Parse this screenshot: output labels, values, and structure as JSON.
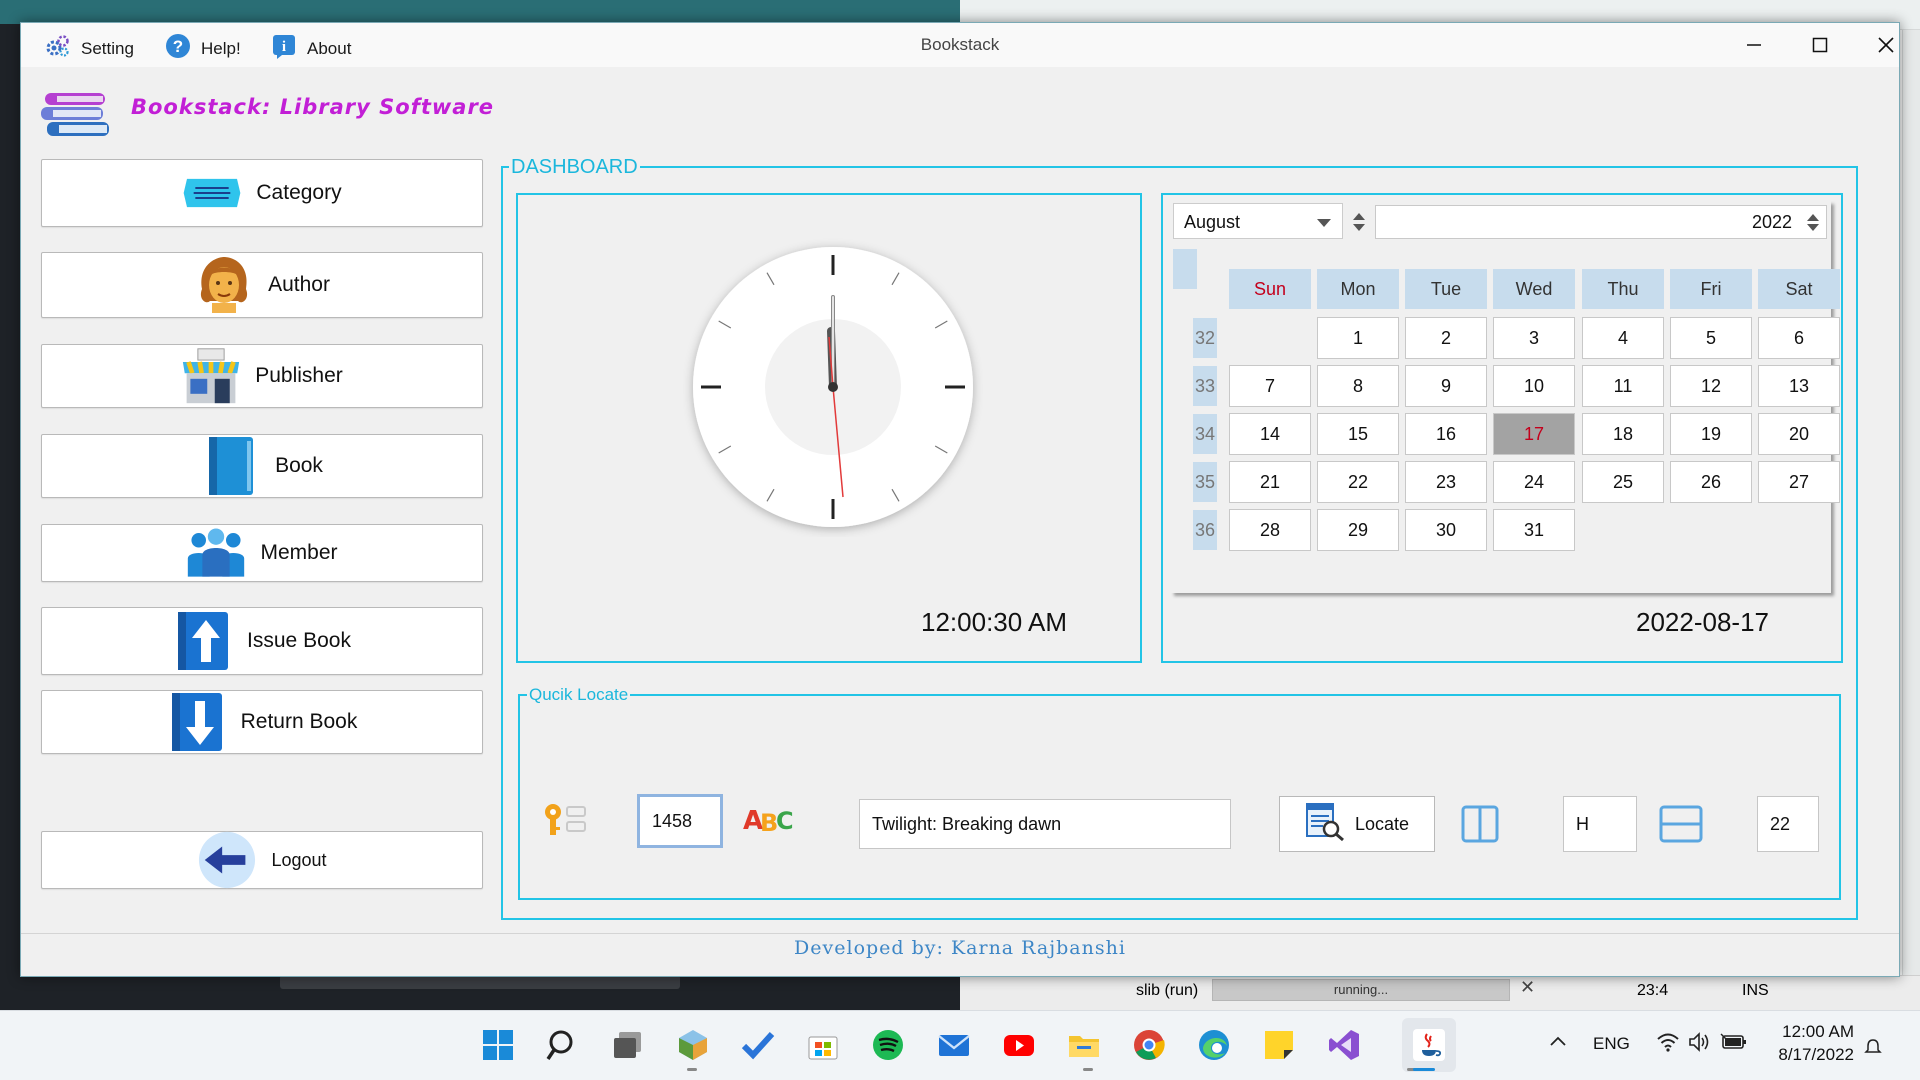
{
  "window": {
    "title": "Bookstack",
    "menu": [
      {
        "label": "Setting",
        "icon": "gears-icon"
      },
      {
        "label": "Help!",
        "icon": "help-icon"
      },
      {
        "label": "About",
        "icon": "info-icon"
      }
    ]
  },
  "app": {
    "title": "Bookstack: Library Software",
    "title_color": "#c21fd6",
    "logo_icon": "books-stack-icon"
  },
  "sidebar": {
    "items": [
      {
        "label": "Category",
        "icon": "category-icon"
      },
      {
        "label": "Author",
        "icon": "author-icon"
      },
      {
        "label": "Publisher",
        "icon": "publisher-icon"
      },
      {
        "label": "Book",
        "icon": "book-icon"
      },
      {
        "label": "Member",
        "icon": "member-icon"
      },
      {
        "label": "Issue Book",
        "icon": "issue-book-icon"
      },
      {
        "label": "Return Book",
        "icon": "return-book-icon"
      }
    ],
    "logout": {
      "label": "Logout",
      "icon": "back-arrow-icon"
    }
  },
  "dashboard": {
    "legend": "DASHBOARD",
    "accent_color": "#22c4e6",
    "time": "12:00:30 AM",
    "date": "2022-08-17",
    "calendar": {
      "month": "August",
      "year": "2022",
      "weekdays": [
        "Sun",
        "Mon",
        "Tue",
        "Wed",
        "Thu",
        "Fri",
        "Sat"
      ],
      "weeks": [
        {
          "num": "32",
          "days": [
            "",
            "1",
            "2",
            "3",
            "4",
            "5",
            "6"
          ]
        },
        {
          "num": "33",
          "days": [
            "7",
            "8",
            "9",
            "10",
            "11",
            "12",
            "13"
          ]
        },
        {
          "num": "34",
          "days": [
            "14",
            "15",
            "16",
            "17",
            "18",
            "19",
            "20"
          ]
        },
        {
          "num": "35",
          "days": [
            "21",
            "22",
            "23",
            "24",
            "25",
            "26",
            "27"
          ]
        },
        {
          "num": "36",
          "days": [
            "28",
            "29",
            "30",
            "31",
            "",
            "",
            ""
          ]
        }
      ],
      "selected_day": "17"
    }
  },
  "quick_locate": {
    "legend": "Qucik Locate",
    "book_id": "1458",
    "book_title": "Twilight: Breaking dawn",
    "locate_label": "Locate",
    "shelf_value": "H",
    "row_value": "22"
  },
  "footer": "Developed by: Karna Rajbanshi",
  "ide_status": {
    "run_label": "slib (run)",
    "progress_text": "running...",
    "position": "23:4",
    "mode": "INS"
  },
  "taskbar": {
    "icons": [
      "windows-start-icon",
      "search-icon",
      "task-view-icon",
      "netbeans-icon",
      "todo-icon",
      "store-icon",
      "spotify-icon",
      "mail-icon",
      "youtube-icon",
      "file-explorer-icon",
      "chrome-icon",
      "edge-icon",
      "sticky-notes-icon",
      "visual-studio-icon",
      "java-icon"
    ],
    "language": "ENG",
    "clock_time": "12:00 AM",
    "clock_date": "8/17/2022"
  }
}
